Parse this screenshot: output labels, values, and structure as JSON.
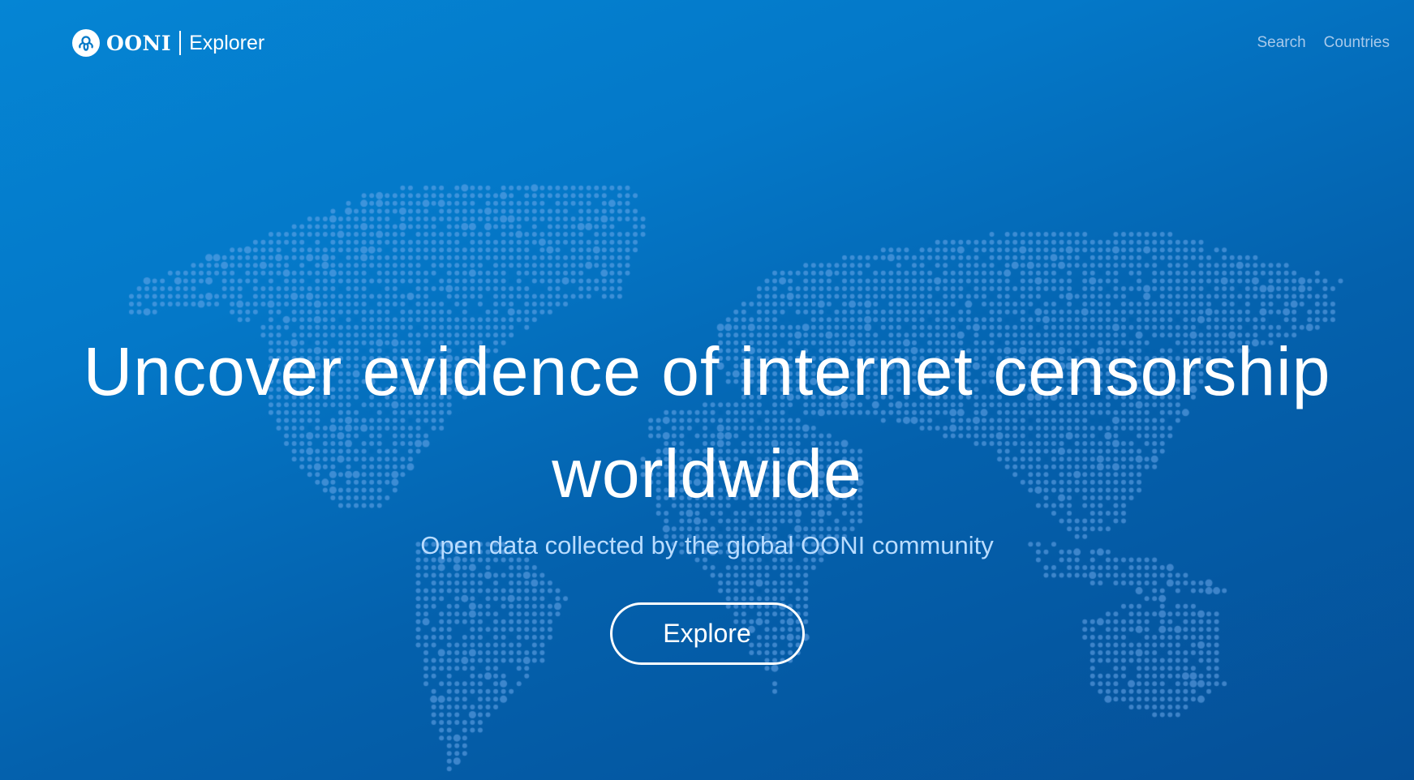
{
  "nav": {
    "logo_name": "OONI",
    "logo_product": "Explorer",
    "links": [
      "Search",
      "Countries"
    ]
  },
  "hero": {
    "title_line1": "Uncover evidence of internet censorship",
    "title_line2": "worldwide",
    "subtitle": "Open data collected by the global OONI community",
    "cta_label": "Explore"
  },
  "colors": {
    "dot": "#5fa6e6",
    "subtitle": "#b9dcff",
    "nav_link": "#a8c9ea"
  }
}
